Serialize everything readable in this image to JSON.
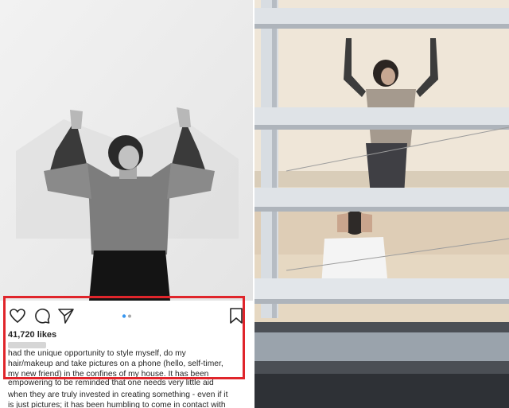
{
  "post": {
    "likes": "41,720 likes",
    "caption_lines": [
      "had the unique opportunity to style myself, do my",
      "hair/makeup and take pictures on a phone (hello, self-timer,",
      "my new friend) in the confines of my house. It has been",
      "empowering to be reminded that one needs very little aid",
      "when they are truly invested in creating something - even if it",
      "is just pictures; it has been humbling to come in contact with"
    ]
  },
  "icons": {
    "like": "heart-icon",
    "comment": "comment-icon",
    "share": "send-icon",
    "save": "bookmark-icon",
    "carousel": "carousel-dots-icon"
  },
  "colors": {
    "highlight": "#e0252b",
    "carousel_active": "#3897f0"
  }
}
